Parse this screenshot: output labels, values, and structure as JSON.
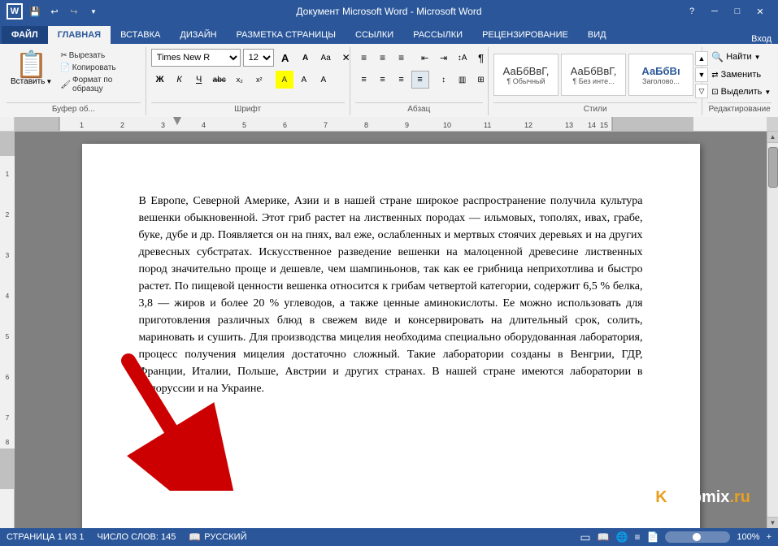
{
  "titlebar": {
    "title": "Документ Microsoft Word - Microsoft Word",
    "help_btn": "?",
    "minimize_btn": "─",
    "restore_btn": "□",
    "close_btn": "✕"
  },
  "quickaccess": {
    "save": "💾",
    "undo": "↩",
    "redo": "↪",
    "customize": "▼"
  },
  "tabs": [
    {
      "label": "ФАЙЛ",
      "active": false
    },
    {
      "label": "ГЛАВНАЯ",
      "active": true
    },
    {
      "label": "ВСТАВКА",
      "active": false
    },
    {
      "label": "ДИЗАЙН",
      "active": false
    },
    {
      "label": "РАЗМЕТКА СТРАНИЦЫ",
      "active": false
    },
    {
      "label": "ССЫЛКИ",
      "active": false
    },
    {
      "label": "РАССЫЛКИ",
      "active": false
    },
    {
      "label": "РЕЦЕНЗИРОВАНИЕ",
      "active": false
    },
    {
      "label": "ВИД",
      "active": false
    }
  ],
  "ribbon": {
    "paste_label": "Вставить",
    "clipboard_label": "Буфер об...",
    "font_name": "Times New R",
    "font_size": "12",
    "font_label": "Шрифт",
    "paragraph_label": "Абзац",
    "styles_label": "Стили",
    "editing_label": "Редактирование",
    "styles": [
      {
        "name": "АаБбВвГ,",
        "label": "¶ Обычный"
      },
      {
        "name": "АаБбВвГ,",
        "label": "¶ Без инте..."
      },
      {
        "name": "АаБбВı",
        "label": "Заголово..."
      }
    ],
    "find_label": "Найти",
    "replace_label": "Заменить",
    "select_label": "Выделить"
  },
  "document": {
    "text": "В Европе, Северной Америке, Азии и в нашей стране широкое распространение получила культура вешенки обыкновенной. Этот гриб растет на лиственных породах — ильмовых, тополях, ивах, грабе, буке, дубе и др. Появляется он на пнях, вал еже, ослабленных и мертвых стоячих деревьях и на других древесных субстратах. Искусственное разведение вешенки на малоценной древесине лиственных пород значительно проще и дешевле, чем шампиньонов, так как ее грибница неприхотлива и быстро растет. По пищевой ценности вешенка относится к грибам четвертой категории, содержит 6,5 % белка, 3,8 — жиров и более 20 % углеводов, а также ценные аминокислоты. Ее можно использовать для приготовления различных блюд в свежем виде и консервировать на длительный срок, солить, мариновать и сушить. Для производства мицелия необходима специально оборудованная лаборатория, процесс получения мицелия достаточно сложный. Такие лаборатории созданы в Венгрии, ГДР, Франции, Италии, Польше, Австрии и других странах. В нашей стране имеются лаборатории в Белоруссии и на Украине."
  },
  "statusbar": {
    "page_info": "СТРАНИЦА 1 ИЗ 1",
    "word_count": "ЧИСЛО СЛОВ: 145",
    "language": "РУССКИЙ",
    "login": "Вход"
  },
  "watermark": {
    "text": "Kompmix.ru",
    "k": "K",
    "rest": "ompmix",
    "dot": ".",
    "ru": "ru"
  }
}
